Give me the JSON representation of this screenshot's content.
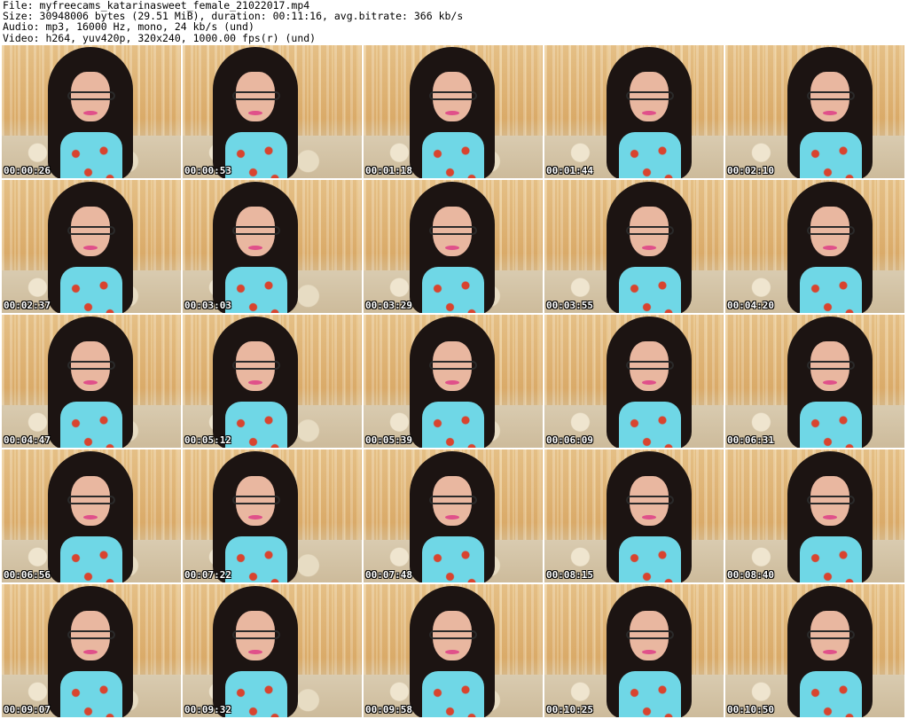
{
  "header": {
    "file_line": "File: myfreecams_katarinasweet_female_21022017.mp4",
    "size_line": "Size: 30948006 bytes (29.51 MiB), duration: 00:11:16, avg.bitrate: 366 kb/s",
    "audio_line": "Audio: mp3, 16000 Hz, mono, 24 kb/s (und)",
    "video_line": "Video: h264, yuv420p, 320x240, 1000.00 fps(r) (und)"
  },
  "thumbnails": [
    {
      "timestamp": "00:00:26"
    },
    {
      "timestamp": "00:00:53"
    },
    {
      "timestamp": "00:01:18"
    },
    {
      "timestamp": "00:01:44"
    },
    {
      "timestamp": "00:02:10"
    },
    {
      "timestamp": "00:02:37"
    },
    {
      "timestamp": "00:03:03"
    },
    {
      "timestamp": "00:03:29"
    },
    {
      "timestamp": "00:03:55"
    },
    {
      "timestamp": "00:04:20"
    },
    {
      "timestamp": "00:04:47"
    },
    {
      "timestamp": "00:05:12"
    },
    {
      "timestamp": "00:05:39"
    },
    {
      "timestamp": "00:06:09"
    },
    {
      "timestamp": "00:06:31"
    },
    {
      "timestamp": "00:06:56"
    },
    {
      "timestamp": "00:07:22"
    },
    {
      "timestamp": "00:07:48"
    },
    {
      "timestamp": "00:08:15"
    },
    {
      "timestamp": "00:08:40"
    },
    {
      "timestamp": "00:09:07"
    },
    {
      "timestamp": "00:09:32"
    },
    {
      "timestamp": "00:09:58"
    },
    {
      "timestamp": "00:10:25"
    },
    {
      "timestamp": "00:10:50"
    }
  ]
}
